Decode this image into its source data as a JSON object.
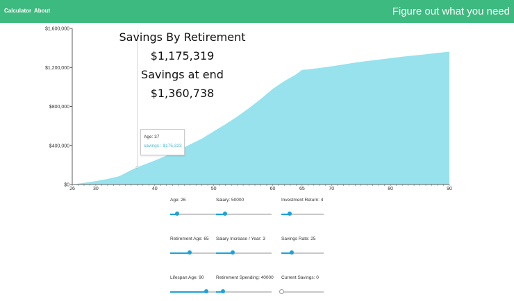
{
  "nav": {
    "calculator": "Calculator",
    "about": "About",
    "title": "Figure out what you need"
  },
  "summary": {
    "retirement_label": "Savings By Retirement",
    "retirement_value": "$1,175,319",
    "end_label": "Savings at end",
    "end_value": "$1,360,738"
  },
  "tooltip": {
    "age": "Age: 37",
    "savings": "savings : $175,323"
  },
  "chart_data": {
    "type": "area",
    "x": [
      26,
      28,
      30,
      32,
      34,
      36,
      37,
      40,
      42,
      44,
      46,
      48,
      50,
      52,
      54,
      56,
      58,
      60,
      62,
      64,
      65,
      66,
      68,
      70,
      72,
      74,
      76,
      78,
      80,
      82,
      84,
      86,
      88,
      90
    ],
    "series": [
      {
        "name": "savings",
        "color": "#97e2ec",
        "values": [
          0,
          17000,
          35000,
          57000,
          85000,
          148000,
          175323,
          245000,
          297000,
          350000,
          410000,
          470000,
          545000,
          618000,
          697000,
          783000,
          877000,
          980000,
          1060000,
          1130000,
          1175319,
          1180000,
          1195000,
          1212000,
          1230000,
          1250000,
          1266000,
          1280000,
          1295000,
          1310000,
          1323000,
          1335000,
          1349000,
          1360738
        ]
      }
    ],
    "xticks": [
      26,
      30,
      40,
      50,
      60,
      65,
      70,
      80,
      90
    ],
    "yticks": [
      "$0",
      "$400,000",
      "$800,000",
      "$1,200,000",
      "$1,600,000"
    ],
    "ylim": [
      0,
      1600000
    ],
    "xlim": [
      26,
      90
    ]
  },
  "sliders": [
    {
      "label": "Age: 26",
      "value": 0.12
    },
    {
      "label": "Salary: 50000",
      "value": 0.16
    },
    {
      "label": "Investment Return: 4",
      "value": 0.2
    },
    {
      "label": "Retirement Age: 65",
      "value": 0.35
    },
    {
      "label": "Salary Increase / Year: 3",
      "value": 0.3
    },
    {
      "label": "Savings Rate: 25",
      "value": 0.25
    },
    {
      "label": "Lifespan Age: 90",
      "value": 0.65
    },
    {
      "label": "Retirement Spending: 40000",
      "value": 0.12
    },
    {
      "label": "Current Savings: 0",
      "value": 0
    }
  ]
}
